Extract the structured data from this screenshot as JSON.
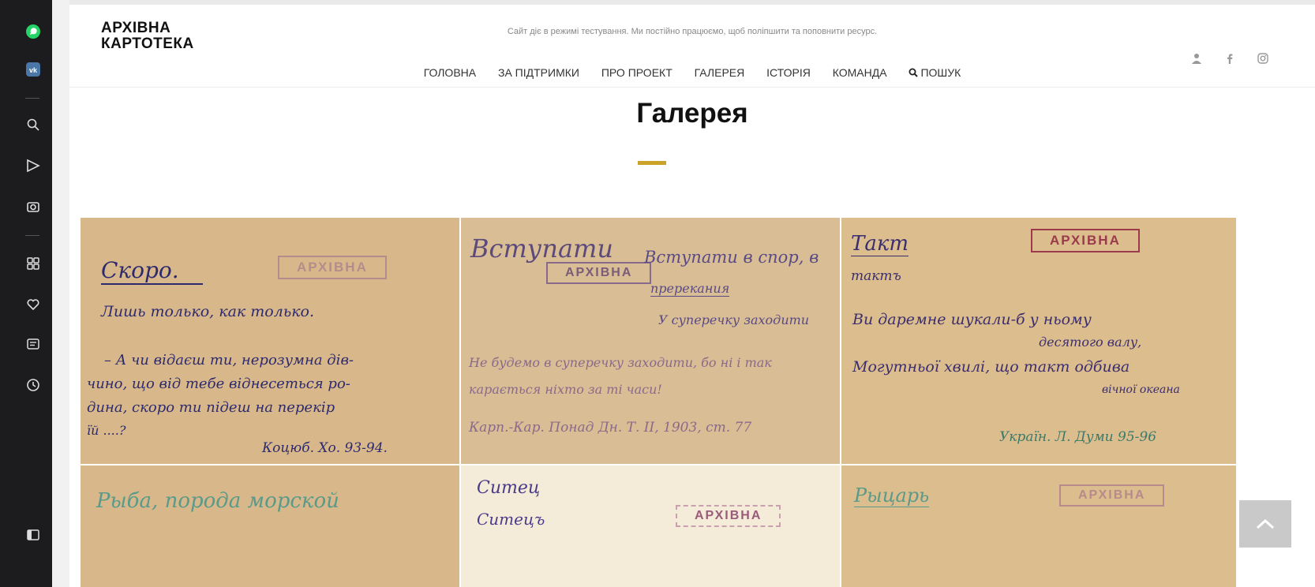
{
  "site": {
    "logo_line1": "АРХІВНА",
    "logo_line2": "КАРТОТЕКА",
    "notice": "Сайт діє в режимі тестування. Ми постійно працюємо, щоб поліпшити та поповнити ресурс.",
    "nav": [
      "ГОЛОВНА",
      "ЗА ПІДТРИМКИ",
      "ПРО ПРОЕКТ",
      "ГАЛЕРЕЯ",
      "ІСТОРІЯ",
      "КОМАНДА"
    ],
    "search_label": "ПОШУК",
    "social_icons": [
      "user-icon",
      "facebook-icon",
      "instagram-icon"
    ],
    "page_title": "Галерея",
    "accent_color": "#c9a227"
  },
  "sidebar": {
    "icons": [
      "whatsapp-icon",
      "vk-icon",
      "search-icon",
      "send-icon",
      "camera-icon",
      "apps-icon",
      "heart-icon",
      "notes-icon",
      "history-icon",
      "panel-icon"
    ],
    "whatsapp_color": "#25d366",
    "vk_color": "#4a76a8"
  },
  "gallery": {
    "cards": [
      {
        "headword": "Скоро.",
        "stamp": "АРХІВНА",
        "lines": [
          "Лишь только, как только.",
          "– А чи відаєш ти, нерозумна дів-",
          "чино, що від тебе віднесеться ро-",
          "дина, скоро ти підеш на перекір",
          "їй ....?",
          "Коцюб. Хо. 93-94."
        ]
      },
      {
        "headword": "Вступати",
        "stamp": "АРХІВНА",
        "lines": [
          "Вступати в спор, в",
          "пререкания",
          "У суперечку заходити",
          "Не будемо в суперечку заходити, бо ні і так",
          "карається ніхто за ті часи!",
          "Карп.-Кар. Понад Дн. Т. ІІ, 1903, ст. 77"
        ]
      },
      {
        "headword": "Такт",
        "stamp": "АРХІВНА",
        "lines": [
          "тактъ",
          "Ви даремне шукали-б у ньому",
          "десятого валу,",
          "Могутньої хвилі, що такт одбива",
          "вічної океана",
          "Україн. Л. Думи 95-96"
        ]
      },
      {
        "headword": "Рыба, порода морской",
        "stamp": "",
        "lines": []
      },
      {
        "headword": "Ситец",
        "stamp": "АРХІВНА",
        "lines": [
          "Ситецъ"
        ]
      },
      {
        "headword": "Рыцарь",
        "stamp": "АРХІВНА",
        "lines": []
      }
    ]
  }
}
